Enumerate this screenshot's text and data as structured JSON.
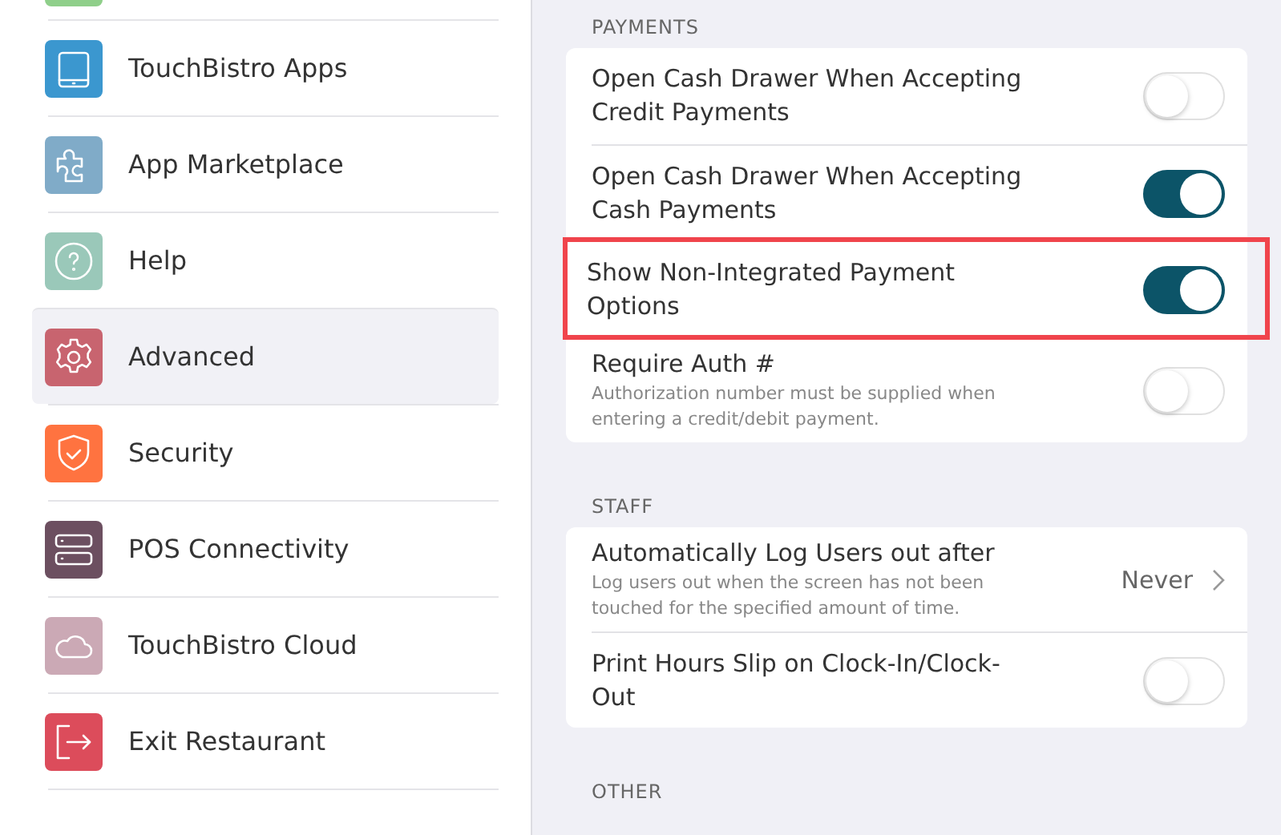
{
  "sidebar": {
    "items": [
      {
        "label": "TouchBistro Apps",
        "color": "#3b97cf",
        "selected": false
      },
      {
        "label": "App Marketplace",
        "color": "#80abc8",
        "selected": false
      },
      {
        "label": "Help",
        "color": "#9ac8b9",
        "selected": false
      },
      {
        "label": "Advanced",
        "color": "#c8646f",
        "selected": true
      },
      {
        "label": "Security",
        "color": "#ff7340",
        "selected": false
      },
      {
        "label": "POS Connectivity",
        "color": "#6c4f60",
        "selected": false
      },
      {
        "label": "TouchBistro Cloud",
        "color": "#cba9b5",
        "selected": false
      },
      {
        "label": "Exit Restaurant",
        "color": "#dc4c5b",
        "selected": false
      }
    ]
  },
  "sections": [
    {
      "title": "PAYMENTS",
      "rows": [
        {
          "kind": "toggle",
          "label": "Open Cash Drawer When Accepting Credit Payments",
          "on": false,
          "highlighted": false
        },
        {
          "kind": "toggle",
          "label": "Open Cash Drawer When Accepting Cash Payments",
          "on": true,
          "highlighted": false
        },
        {
          "kind": "toggle",
          "label": "Show Non-Integrated Payment Options",
          "on": true,
          "highlighted": true
        },
        {
          "kind": "toggle",
          "label": "Require Auth #",
          "description": "Authorization number must be supplied when entering a credit/debit payment.",
          "on": false,
          "highlighted": false
        }
      ]
    },
    {
      "title": "STAFF",
      "rows": [
        {
          "kind": "select",
          "label": "Automatically Log Users out after",
          "description": "Log users out when the screen has not been touched for the specified amount of time.",
          "value": "Never",
          "highlighted": false
        },
        {
          "kind": "toggle",
          "label": "Print Hours Slip on Clock-In/Clock-Out",
          "on": false,
          "highlighted": false
        }
      ]
    },
    {
      "title": "OTHER"
    }
  ]
}
